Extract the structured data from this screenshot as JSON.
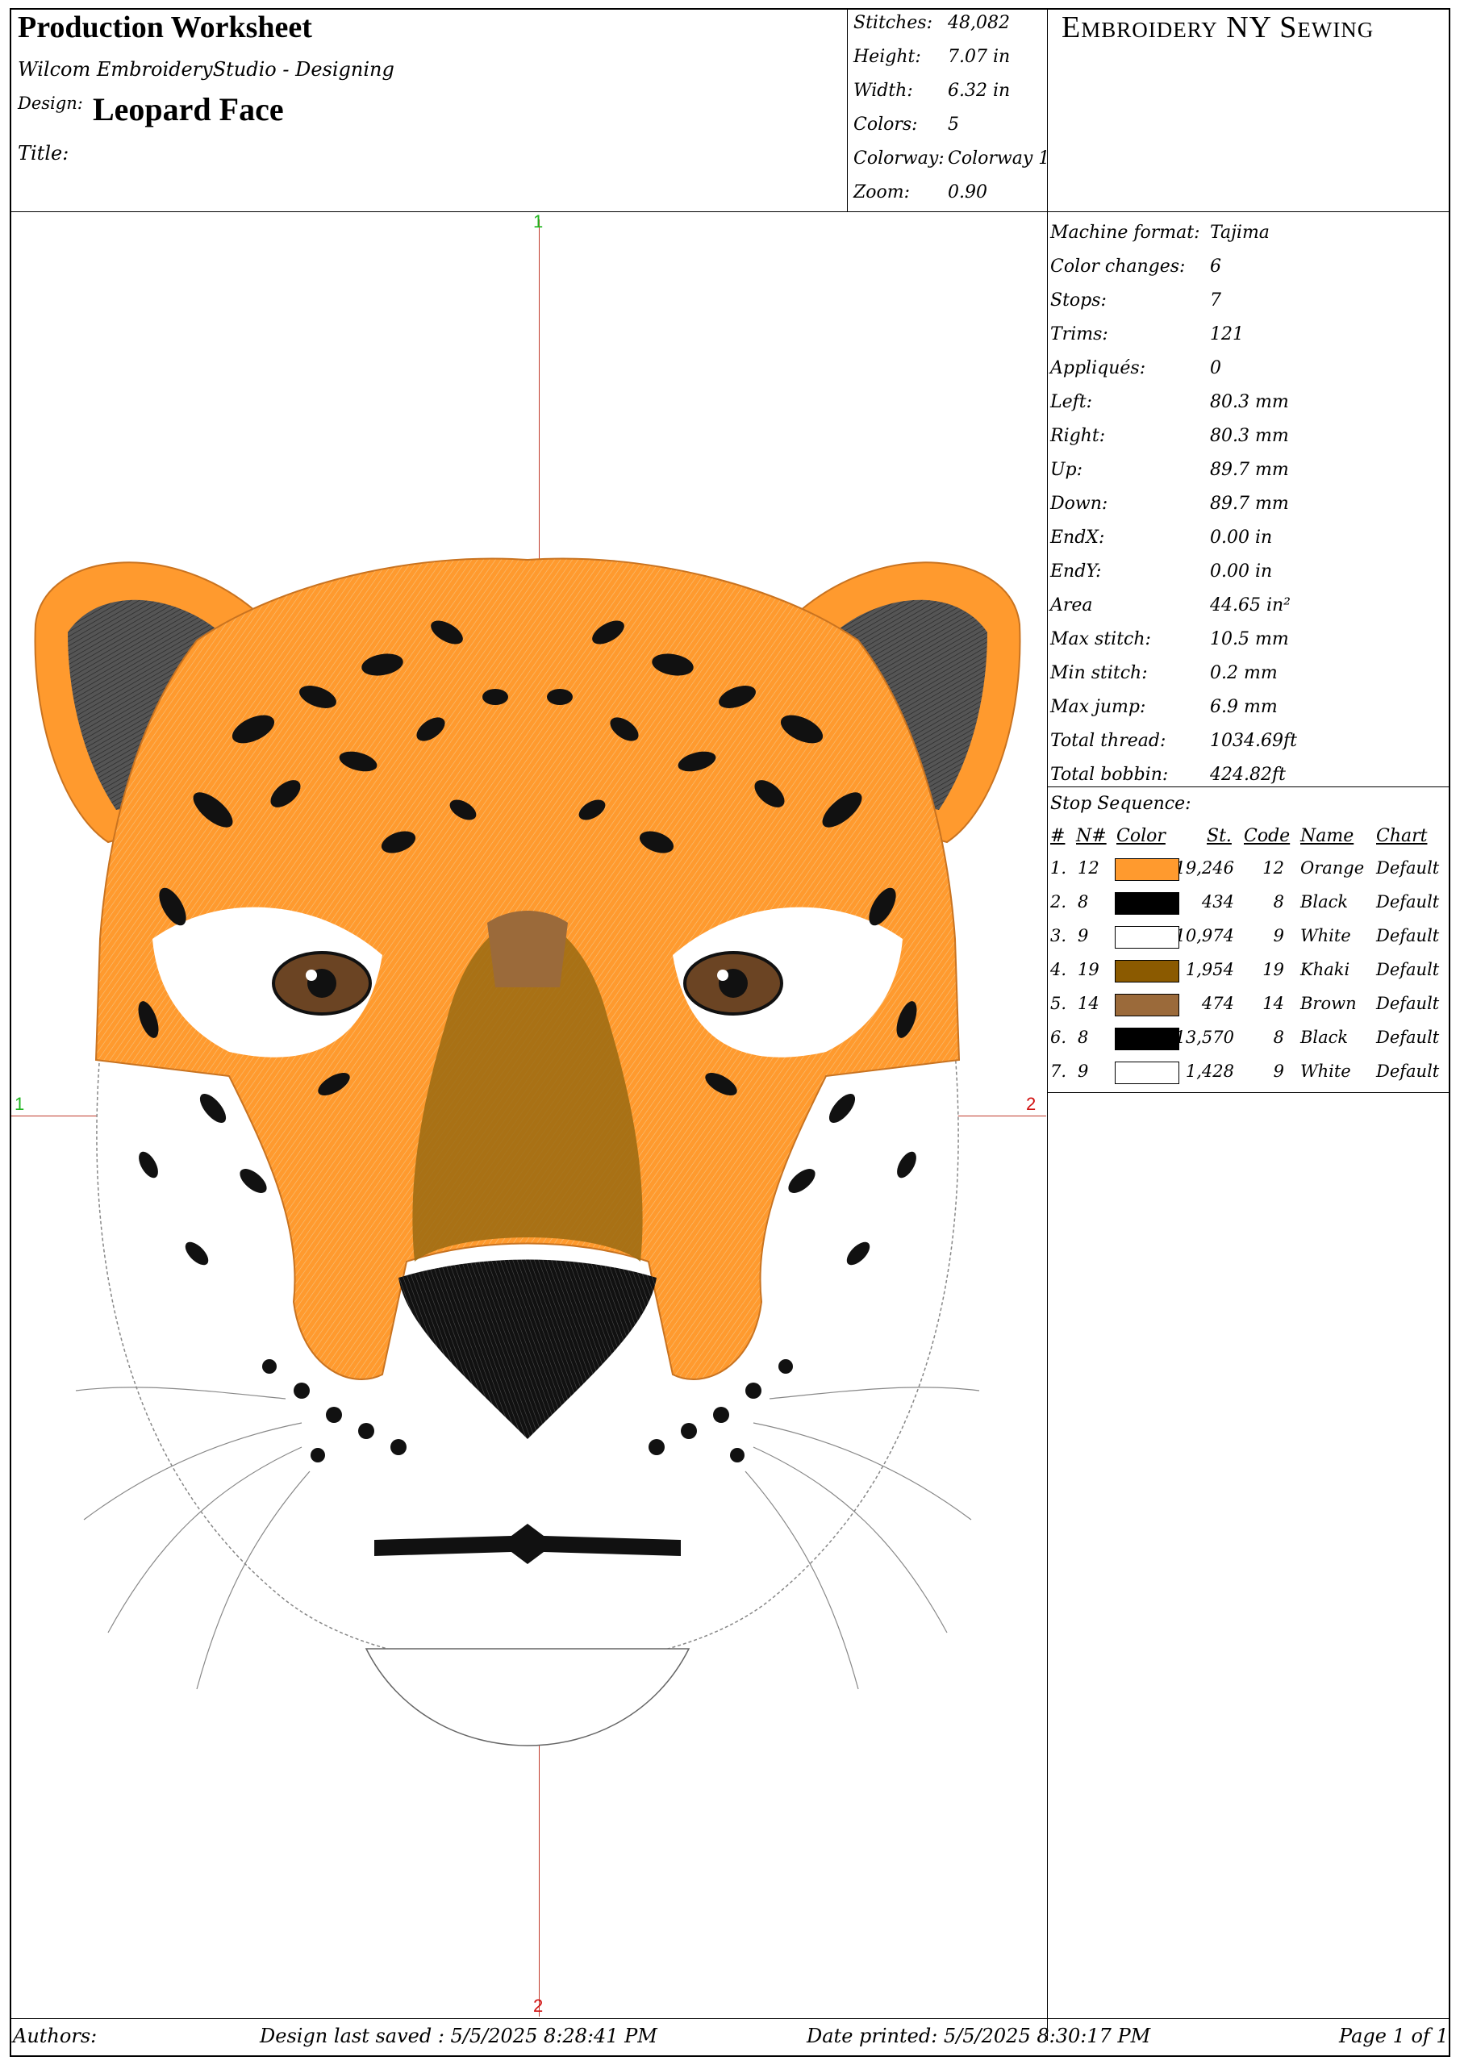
{
  "header": {
    "title": "Production Worksheet",
    "software": "Wilcom EmbroideryStudio - Designing",
    "design_label": "Design:",
    "design_name": "Leopard Face",
    "title_label": "Title:",
    "title_value": ""
  },
  "stats": {
    "stitches_label": "Stitches:",
    "stitches": "48,082",
    "height_label": "Height:",
    "height": "7.07  in",
    "width_label": "Width:",
    "width": "6.32  in",
    "colors_label": "Colors:",
    "colors": "5",
    "colorway_label": "Colorway:",
    "colorway": "Colorway 1",
    "zoom_label": "Zoom:",
    "zoom": "0.90"
  },
  "brand": "Embroidery NY Sewing",
  "machine_info": [
    {
      "label": "Machine format:",
      "value": "Tajima"
    },
    {
      "label": "Color changes:",
      "value": "6"
    },
    {
      "label": "Stops:",
      "value": "7"
    },
    {
      "label": "Trims:",
      "value": "121"
    },
    {
      "label": "Appliqués:",
      "value": "0"
    },
    {
      "label": "Left:",
      "value": "80.3  mm"
    },
    {
      "label": "Right:",
      "value": "80.3  mm"
    },
    {
      "label": "Up:",
      "value": "89.7  mm"
    },
    {
      "label": "Down:",
      "value": "89.7  mm"
    },
    {
      "label": "EndX:",
      "value": "0.00  in"
    },
    {
      "label": "EndY:",
      "value": "0.00  in"
    },
    {
      "label": "Area",
      "value": "44.65  in²"
    },
    {
      "label": "Max stitch:",
      "value": "10.5  mm"
    },
    {
      "label": "Min stitch:",
      "value": "0.2  mm"
    },
    {
      "label": "Max jump:",
      "value": "6.9  mm"
    },
    {
      "label": "Total thread:",
      "value": "1034.69ft"
    },
    {
      "label": "Total bobbin:",
      "value": "424.82ft"
    }
  ],
  "stop_sequence": {
    "title": "Stop Sequence:",
    "headers": {
      "num": "#",
      "n": "N#",
      "color": "Color",
      "st": "St.",
      "code": "Code",
      "name": "Name",
      "chart": "Chart"
    },
    "rows": [
      {
        "num": "1.",
        "n": "12",
        "color": "#FF9A2E",
        "st": "19,246",
        "code": "12",
        "name": "Orange",
        "chart": "Default"
      },
      {
        "num": "2.",
        "n": "8",
        "color": "#000000",
        "st": "434",
        "code": "8",
        "name": "Black",
        "chart": "Default"
      },
      {
        "num": "3.",
        "n": "9",
        "color": "#FFFFFF",
        "st": "10,974",
        "code": "9",
        "name": "White",
        "chart": "Default"
      },
      {
        "num": "4.",
        "n": "19",
        "color": "#8B5A00",
        "st": "1,954",
        "code": "19",
        "name": "Khaki",
        "chart": "Default"
      },
      {
        "num": "5.",
        "n": "14",
        "color": "#9B6A3A",
        "st": "474",
        "code": "14",
        "name": "Brown",
        "chart": "Default"
      },
      {
        "num": "6.",
        "n": "8",
        "color": "#000000",
        "st": "13,570",
        "code": "8",
        "name": "Black",
        "chart": "Default"
      },
      {
        "num": "7.",
        "n": "9",
        "color": "#FFFFFF",
        "st": "1,428",
        "code": "9",
        "name": "White",
        "chart": "Default"
      }
    ]
  },
  "axes": {
    "top": "1",
    "bottom": "2",
    "left": "1",
    "right": "2"
  },
  "footer": {
    "authors_label": "Authors:",
    "saved": "Design last saved : 5/5/2025  8:28:41  PM",
    "printed": "Date printed: 5/5/2025  8:30:17  PM",
    "page": "Page 1 of 1"
  }
}
